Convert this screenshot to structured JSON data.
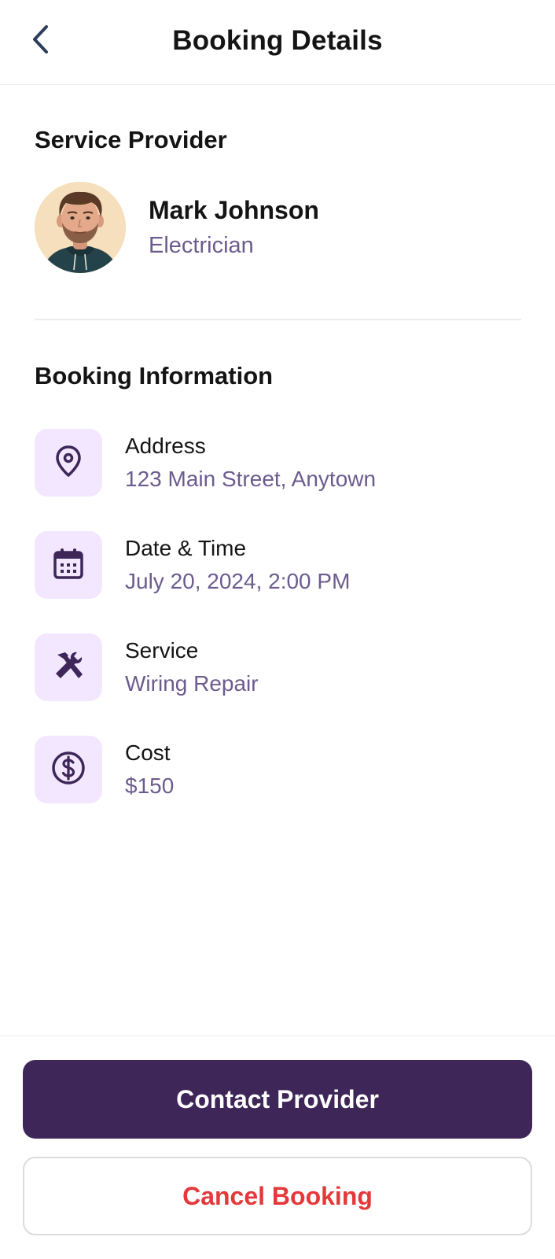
{
  "header": {
    "title": "Booking Details",
    "back_icon": "chevron-left-icon"
  },
  "provider_section": {
    "title": "Service Provider",
    "name": "Mark Johnson",
    "role": "Electrician"
  },
  "booking_section": {
    "title": "Booking Information",
    "items": [
      {
        "icon": "location-pin-icon",
        "label": "Address",
        "value": "123 Main Street, Anytown"
      },
      {
        "icon": "calendar-icon",
        "label": "Date & Time",
        "value": "July 20, 2024, 2:00 PM"
      },
      {
        "icon": "tools-icon",
        "label": "Service",
        "value": "Wiring Repair"
      },
      {
        "icon": "dollar-icon",
        "label": "Cost",
        "value": "$150"
      }
    ]
  },
  "actions": {
    "contact_label": "Contact Provider",
    "cancel_label": "Cancel Booking"
  },
  "colors": {
    "primary": "#3e2758",
    "accent_text": "#6c5c8e",
    "icon_bg": "#f2e7ff",
    "danger": "#e5383b"
  }
}
